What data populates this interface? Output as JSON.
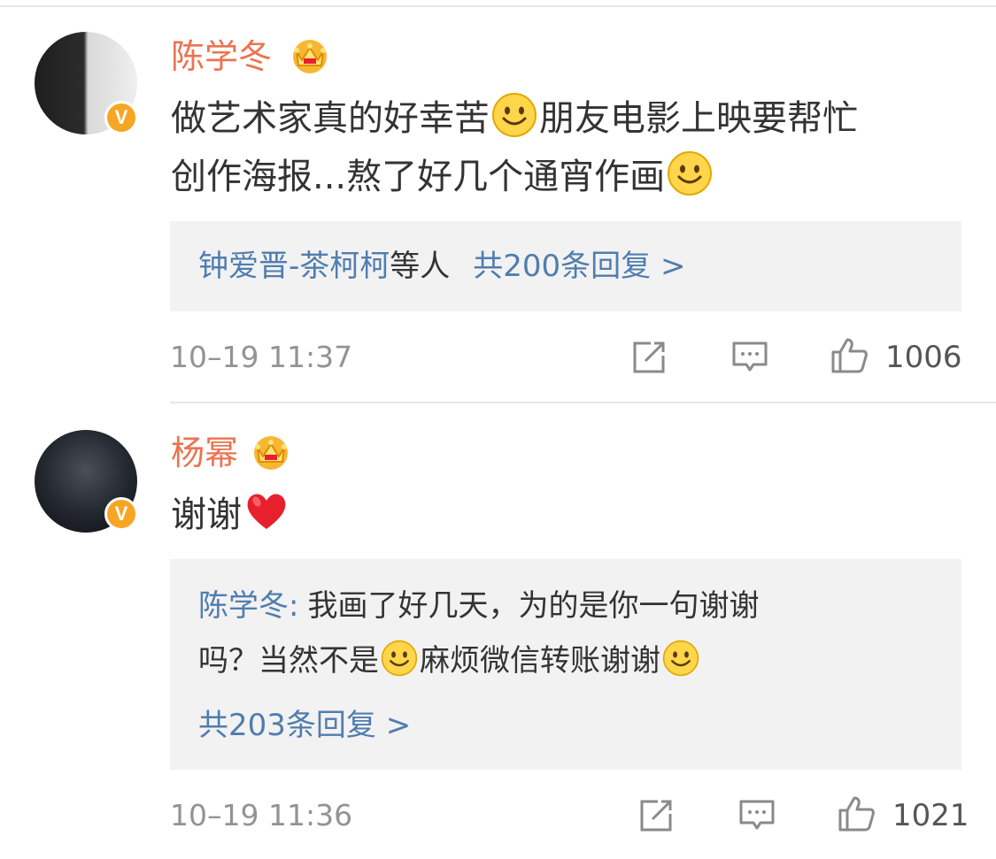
{
  "comments": [
    {
      "author": "陈学冬",
      "content_parts": [
        "做艺术家真的好幸苦",
        "朋友电影上映要帮忙",
        "创作海报...熬了好几个通宵作画"
      ],
      "replies_box": {
        "names": "钟爱晋-茶柯柯",
        "names_suffix": "等人",
        "total": "共200条回复 >"
      },
      "time": "10–19 11:37",
      "like_count": "1006"
    },
    {
      "author": "杨幂",
      "content": "谢谢",
      "replies_box": {
        "reply_author": "陈学冬:",
        "reply_line1": "我画了好几天，为的是你一句谢谢",
        "reply_line2_a": "吗？当然不是",
        "reply_line2_b": "麻烦微信转账谢谢",
        "total": "共203条回复 >"
      },
      "time": "10–19 11:36",
      "like_count": "1021"
    }
  ],
  "icons": {
    "verified_badge_letter": "V",
    "verified": "verified-badge-icon",
    "crown": "crown-icon",
    "emoji_smile": "smile-emoji-icon",
    "emoji_heart": "heart-emoji-icon",
    "share": "share-icon",
    "comment": "comment-icon",
    "like": "like-icon"
  },
  "colors": {
    "author": "#eb7350",
    "link": "#507daf",
    "text": "#333333",
    "muted": "#939393",
    "reply_bg": "#f2f2f2",
    "badge": "#f7a623"
  }
}
